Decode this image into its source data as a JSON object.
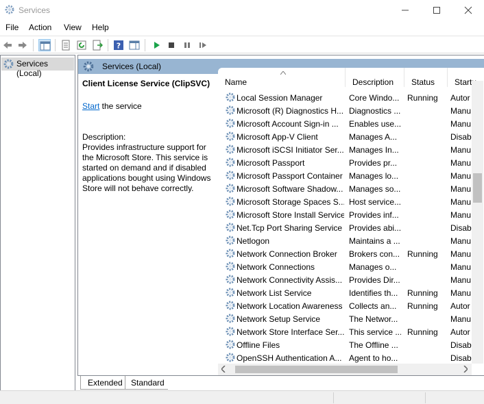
{
  "window": {
    "title": "Services"
  },
  "menu": [
    "File",
    "Action",
    "View",
    "Help"
  ],
  "tree": {
    "root_label": "Services (Local)"
  },
  "header": {
    "label": "Services (Local)"
  },
  "details": {
    "service_name": "Client License Service (ClipSVC)",
    "start_link": "Start",
    "start_suffix": " the service",
    "description_label": "Description:",
    "description_text": "Provides infrastructure support for the Microsoft Store. This service is started on demand and if disabled applications bought using Windows Store will not behave correctly."
  },
  "columns": {
    "name": "Name",
    "description": "Description",
    "status": "Status",
    "startup": "Startu"
  },
  "services": [
    {
      "name": "Local Session Manager",
      "description": "Core Windo...",
      "status": "Running",
      "startup": "Autor"
    },
    {
      "name": "Microsoft (R) Diagnostics H...",
      "description": "Diagnostics ...",
      "status": "",
      "startup": "Manu"
    },
    {
      "name": "Microsoft Account Sign-in ...",
      "description": "Enables use...",
      "status": "",
      "startup": "Manu"
    },
    {
      "name": "Microsoft App-V Client",
      "description": "Manages A...",
      "status": "",
      "startup": "Disab"
    },
    {
      "name": "Microsoft iSCSI Initiator Ser...",
      "description": "Manages In...",
      "status": "",
      "startup": "Manu"
    },
    {
      "name": "Microsoft Passport",
      "description": "Provides pr...",
      "status": "",
      "startup": "Manu"
    },
    {
      "name": "Microsoft Passport Container",
      "description": "Manages lo...",
      "status": "",
      "startup": "Manu"
    },
    {
      "name": "Microsoft Software Shadow...",
      "description": "Manages so...",
      "status": "",
      "startup": "Manu"
    },
    {
      "name": "Microsoft Storage Spaces S...",
      "description": "Host service...",
      "status": "",
      "startup": "Manu"
    },
    {
      "name": "Microsoft Store Install Service",
      "description": "Provides inf...",
      "status": "",
      "startup": "Manu"
    },
    {
      "name": "Net.Tcp Port Sharing Service",
      "description": "Provides abi...",
      "status": "",
      "startup": "Disab"
    },
    {
      "name": "Netlogon",
      "description": "Maintains a ...",
      "status": "",
      "startup": "Manu"
    },
    {
      "name": "Network Connection Broker",
      "description": "Brokers con...",
      "status": "Running",
      "startup": "Manu"
    },
    {
      "name": "Network Connections",
      "description": "Manages o...",
      "status": "",
      "startup": "Manu"
    },
    {
      "name": "Network Connectivity Assis...",
      "description": "Provides Dir...",
      "status": "",
      "startup": "Manu"
    },
    {
      "name": "Network List Service",
      "description": "Identifies th...",
      "status": "Running",
      "startup": "Manu"
    },
    {
      "name": "Network Location Awareness",
      "description": "Collects an...",
      "status": "Running",
      "startup": "Autor"
    },
    {
      "name": "Network Setup Service",
      "description": "The Networ...",
      "status": "",
      "startup": "Manu"
    },
    {
      "name": "Network Store Interface Ser...",
      "description": "This service ...",
      "status": "Running",
      "startup": "Autor"
    },
    {
      "name": "Offline Files",
      "description": "The Offline ...",
      "status": "",
      "startup": "Disab"
    },
    {
      "name": "OpenSSH Authentication A...",
      "description": "Agent to ho...",
      "status": "",
      "startup": "Disab"
    }
  ],
  "tabs": [
    "Extended",
    "Standard"
  ],
  "icons": {
    "gear_color": "#6b8fb5",
    "play_color": "#1aa34a",
    "header_bg": "#98b5d2"
  }
}
